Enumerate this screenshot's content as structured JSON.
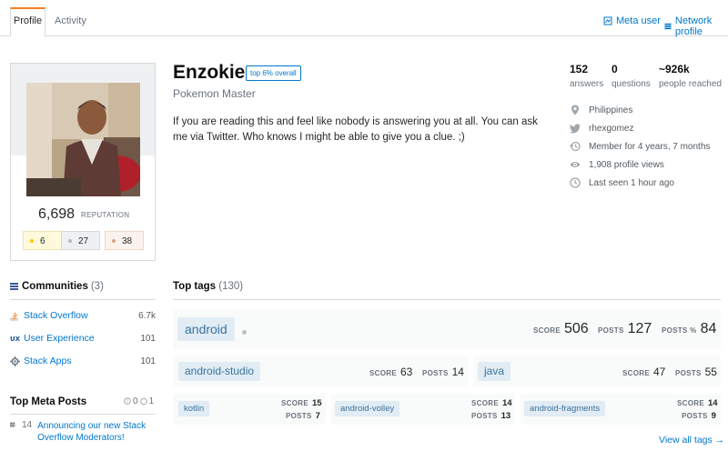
{
  "tabs": [
    {
      "label": "Profile",
      "active": true
    },
    {
      "label": "Activity",
      "active": false
    }
  ],
  "top_links": [
    {
      "label": "Meta user",
      "icon": "meta-user-icon"
    },
    {
      "label": "Network profile",
      "icon": "network-profile-icon"
    }
  ],
  "profile": {
    "name": "Enzokie",
    "top_badge": "top 6% overall",
    "title": "Pokemon Master",
    "bio": "If you are reading this and feel like nobody is answering you at all. You can ask me via Twitter. Who knows I might be able to give you a clue. ;)",
    "reputation": "6,698",
    "reputation_label": "REPUTATION",
    "badges": {
      "gold": "6",
      "silver": "27",
      "bronze": "38"
    },
    "colors": {
      "gold": "#ffcc01",
      "silver": "#b4b8bc",
      "bronze": "#d1a684"
    }
  },
  "stats": [
    {
      "value": "152",
      "label": "answers"
    },
    {
      "value": "0",
      "label": "questions"
    },
    {
      "value": "~926k",
      "label": "people reached"
    }
  ],
  "meta": [
    {
      "icon": "location-icon",
      "text": "Philippines"
    },
    {
      "icon": "twitter-icon",
      "text": "rhexgomez"
    },
    {
      "icon": "history-icon",
      "text": "Member for 4 years, 7 months"
    },
    {
      "icon": "eye-icon",
      "text": "1,908 profile views"
    },
    {
      "icon": "clock-icon",
      "text": "Last seen 1 hour ago"
    }
  ],
  "communities": {
    "title": "Communities",
    "count": "(3)",
    "items": [
      {
        "name": "Stack Overflow",
        "count": "6.7k",
        "icon": "stack-overflow-icon"
      },
      {
        "name": "User Experience",
        "count": "101",
        "icon": "ux-icon"
      },
      {
        "name": "Stack Apps",
        "count": "101",
        "icon": "stack-apps-icon"
      }
    ]
  },
  "meta_posts": {
    "title": "Top Meta Posts",
    "counts": {
      "questions": "0",
      "answers": "1"
    },
    "items": [
      {
        "score": "14",
        "title": "Announcing our new Stack Overflow Moderators!"
      }
    ]
  },
  "top_tags": {
    "title": "Top tags",
    "count": "(130)",
    "primary": {
      "name": "android",
      "score": "506",
      "posts": "127",
      "posts_pct": "84"
    },
    "secondary": [
      {
        "name": "android-studio",
        "score": "63",
        "posts": "14"
      },
      {
        "name": "java",
        "score": "47",
        "posts": "55"
      }
    ],
    "tertiary": [
      {
        "name": "kotlin",
        "score": "15",
        "posts": "7"
      },
      {
        "name": "android-volley",
        "score": "14",
        "posts": "13"
      },
      {
        "name": "android-fragments",
        "score": "14",
        "posts": "9"
      }
    ],
    "labels": {
      "score": "SCORE",
      "posts": "POSTS",
      "posts_pct": "POSTS %"
    },
    "view_all": "View all tags →"
  }
}
